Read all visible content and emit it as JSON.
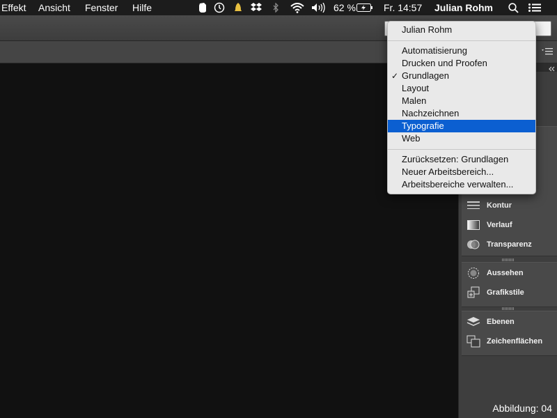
{
  "menubar": {
    "menus": [
      "Effekt",
      "Ansicht",
      "Fenster",
      "Hilfe"
    ],
    "battery_percent": "62 %",
    "clock": "Fr. 14:57",
    "user": "Julian Rohm",
    "status_icons": [
      "evernote-icon",
      "time-machine-icon",
      "bell-icon",
      "dropbox-icon",
      "bluetooth-icon",
      "wifi-icon",
      "volume-icon",
      "battery-icon",
      "search-icon",
      "list-icon"
    ]
  },
  "dropdown": {
    "header": "Julian Rohm",
    "workspaces": [
      {
        "label": "Automatisierung"
      },
      {
        "label": "Drucken und Proofen"
      },
      {
        "label": "Grundlagen",
        "checked": true
      },
      {
        "label": "Layout"
      },
      {
        "label": "Malen"
      },
      {
        "label": "Nachzeichnen"
      },
      {
        "label": "Typografie",
        "highlighted": true
      },
      {
        "label": "Web"
      }
    ],
    "actions": [
      "Zurücksetzen: Grundlagen",
      "Neuer Arbeitsbereich...",
      "Arbeitsbereiche verwalten..."
    ],
    "check_mark": "✓"
  },
  "panels": {
    "group1": [
      {
        "label": "Kontur",
        "icon": "stroke-icon"
      },
      {
        "label": "Verlauf",
        "icon": "gradient-icon"
      },
      {
        "label": "Transparenz",
        "icon": "transparency-icon"
      }
    ],
    "group2": [
      {
        "label": "Aussehen",
        "icon": "appearance-icon"
      },
      {
        "label": "Grafikstile",
        "icon": "graphic-styles-icon"
      }
    ],
    "group3": [
      {
        "label": "Ebenen",
        "icon": "layers-icon"
      },
      {
        "label": "Zeichenflächen",
        "icon": "artboards-icon"
      }
    ]
  },
  "caption": "Abbildung: 04",
  "colors": {
    "highlight": "#0b5fd1",
    "canvas": "#111111",
    "dock": "#3e3e3e"
  }
}
